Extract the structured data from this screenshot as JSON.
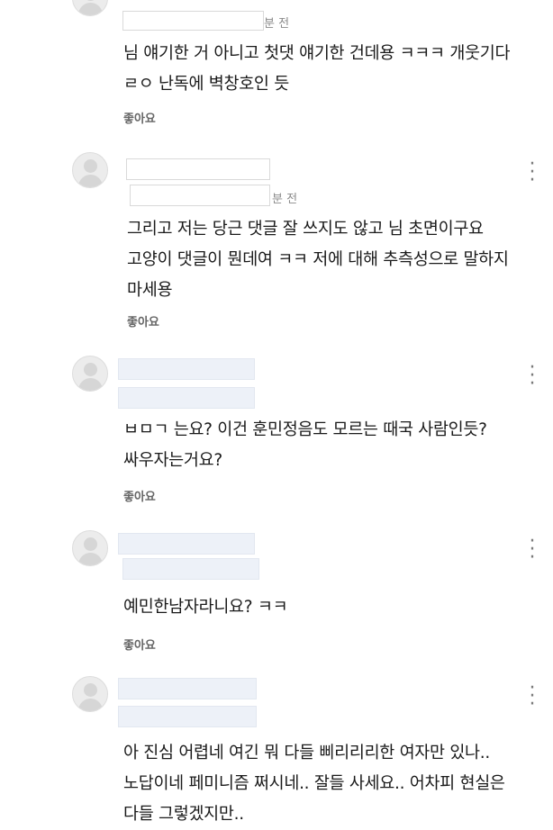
{
  "comments": [
    {
      "time": "분 전",
      "text": "님 얘기한 거 아니고 첫댓 얘기한 건데용 ㅋㅋㅋ 개웃기다\nㄹㅇ 난독에 벽창호인 듯",
      "like_label": "좋아요"
    },
    {
      "time": "분 전",
      "text": "그리고 저는 당근 댓글 잘 쓰지도 않고 님 초면이구요\n고양이 댓글이 뭔데여 ㅋㅋ 저에 대해 추측성으로 말하지\n마세용",
      "like_label": "좋아요"
    },
    {
      "time": "",
      "text": "ㅂㅁㄱ 는요?  이건 훈민정음도 모르는 때국 사람인듯?\n싸우자는거요?",
      "like_label": "좋아요"
    },
    {
      "time": "",
      "text": "예민한남자라니요? ㅋㅋ",
      "like_label": "좋아요"
    },
    {
      "time": "",
      "text": "아 진심 어렵네 여긴 뭐 다들 삐리리리한 여자만 있나..\n노답이네 페미니즘 쩌시네.. 잘들 사세요.. 어차피 현실은\n다들 그렇겠지만..",
      "like_label": ""
    }
  ],
  "icons": {
    "avatar": "default-avatar-icon",
    "more": "more-vertical-icon"
  }
}
